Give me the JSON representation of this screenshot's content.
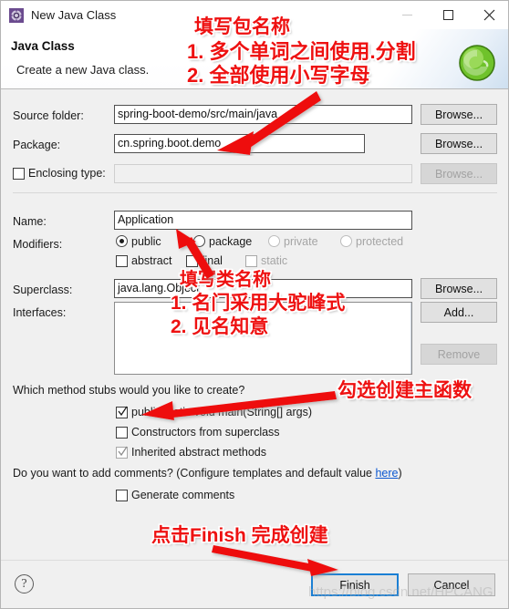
{
  "window": {
    "title": "New Java Class",
    "icon": "eclipse-gear-icon",
    "minimize_label": "—",
    "maximize_label": "□",
    "close_label": "✕"
  },
  "header": {
    "title": "Java Class",
    "subtitle": "Create a new Java class.",
    "banner_icon": "green-java-class-icon"
  },
  "form": {
    "source_folder": {
      "label": "Source folder:",
      "value": "spring-boot-demo/src/main/java",
      "browse": "Browse..."
    },
    "package": {
      "label": "Package:",
      "value": "cn.spring.boot.demo",
      "browse": "Browse..."
    },
    "enclosing_type": {
      "label": "Enclosing type:",
      "value": "",
      "checked": false,
      "browse": "Browse...",
      "disabled": true
    },
    "name": {
      "label": "Name:",
      "value": "Application"
    },
    "modifiers": {
      "label": "Modifiers:",
      "radios": [
        {
          "label": "public",
          "checked": true,
          "disabled": false
        },
        {
          "label": "package",
          "checked": false,
          "disabled": false
        },
        {
          "label": "private",
          "checked": false,
          "disabled": true
        },
        {
          "label": "protected",
          "checked": false,
          "disabled": true
        }
      ],
      "checkboxes": [
        {
          "label": "abstract",
          "checked": false,
          "disabled": false
        },
        {
          "label": "final",
          "checked": false,
          "disabled": false
        },
        {
          "label": "static",
          "checked": false,
          "disabled": true
        }
      ]
    },
    "superclass": {
      "label": "Superclass:",
      "value": "java.lang.Object",
      "browse": "Browse..."
    },
    "interfaces": {
      "label": "Interfaces:",
      "items": [],
      "add": "Add...",
      "remove": "Remove"
    },
    "method_stubs": {
      "question": "Which method stubs would you like to create?",
      "options": [
        {
          "label": "public static void main(String[] args)",
          "checked": true,
          "disabled": false
        },
        {
          "label": "Constructors from superclass",
          "checked": false,
          "disabled": false
        },
        {
          "label": "Inherited abstract methods",
          "checked": true,
          "disabled": true
        }
      ]
    },
    "comments": {
      "question_prefix": "Do you want to add comments? (Configure templates and default value ",
      "link": "here",
      "question_suffix": ")",
      "generate": {
        "label": "Generate comments",
        "checked": false
      }
    }
  },
  "footer": {
    "help_icon": "question-mark-icon",
    "finish": "Finish",
    "cancel": "Cancel"
  },
  "annotations": {
    "package_note_line1": "填写包名称",
    "package_note_line2": "1. 多个单词之间使用.分割",
    "package_note_line3": "2. 全部使用小写字母",
    "class_note_line1": "填写类名称",
    "class_note_line2": "1. 名门采用大驼峰式",
    "class_note_line3": "2. 见名知意",
    "main_note": "勾选创建主函数",
    "finish_note": "点击Finish 完成创建",
    "accent_color": "#ee1111"
  },
  "watermark": {
    "text": "https://blog.csdn.net/HPCANG"
  }
}
